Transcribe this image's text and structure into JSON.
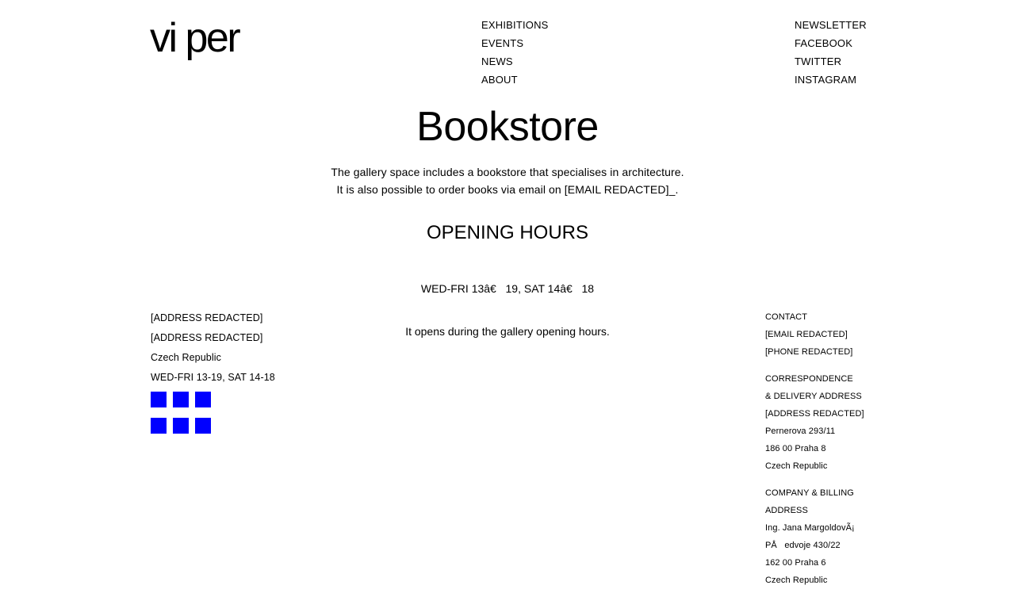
{
  "header": {
    "logo": "vi per",
    "nav_main": [
      "EXHIBITIONS",
      "EVENTS",
      "NEWS",
      "ABOUT"
    ],
    "nav_social": [
      "NEWSLETTER",
      "FACEBOOK",
      "TWITTER",
      "INSTAGRAM"
    ]
  },
  "main": {
    "title": "Bookstore",
    "intro": [
      "The gallery space includes a bookstore that specialises in architecture.",
      "It is also possible to order books via email on [EMAIL REDACTED]_."
    ],
    "hours_heading": "OPENING HOURS",
    "hours_lines": [
      "WED-FRI 13â€   19, SAT 14â€   18",
      "It opens during the gallery opening hours."
    ]
  },
  "footer_left": {
    "lines": [
      "[ADDRESS REDACTED]",
      "[ADDRESS REDACTED]",
      "Czech Republic",
      "WED-FRI 13-19, SAT 14-18"
    ],
    "icon_color": "#0000ff"
  },
  "footer_right": {
    "contact": [
      "CONTACT",
      "[EMAIL REDACTED]",
      "[PHONE REDACTED]"
    ],
    "correspondence": [
      "CORRESPONDENCE",
      "& DELIVERY ADDRESS",
      "[ADDRESS REDACTED]",
      "Pernerova 293/11",
      "186 00 Praha 8",
      "Czech Republic"
    ],
    "billing": [
      "COMPANY & BILLING",
      "ADDRESS",
      "Ing. Jana MargoldovÃ¡",
      "PÅ   edvoje 430/22",
      "162 00 Praha 6",
      "Czech Republic"
    ]
  }
}
